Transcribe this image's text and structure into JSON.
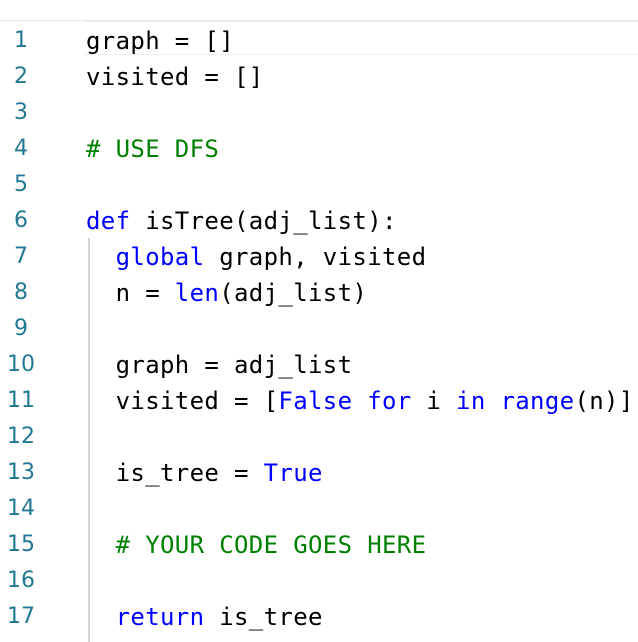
{
  "editor": {
    "lines": [
      {
        "number": "1",
        "tokens": [
          {
            "t": "graph = []",
            "k": "tx"
          }
        ]
      },
      {
        "number": "2",
        "tokens": [
          {
            "t": "visited = []",
            "k": "tx"
          }
        ]
      },
      {
        "number": "3",
        "tokens": []
      },
      {
        "number": "4",
        "tokens": [
          {
            "t": "# USE DFS",
            "k": "cm"
          }
        ]
      },
      {
        "number": "5",
        "tokens": []
      },
      {
        "number": "6",
        "tokens": [
          {
            "t": "def",
            "k": "kw"
          },
          {
            "t": " isTree(adj_list):",
            "k": "tx"
          }
        ]
      },
      {
        "number": "7",
        "tokens": [
          {
            "t": "  ",
            "k": "tx"
          },
          {
            "t": "global",
            "k": "kw"
          },
          {
            "t": " graph, visited",
            "k": "tx"
          }
        ]
      },
      {
        "number": "8",
        "tokens": [
          {
            "t": "  n = ",
            "k": "tx"
          },
          {
            "t": "len",
            "k": "kw"
          },
          {
            "t": "(adj_list)",
            "k": "tx"
          }
        ]
      },
      {
        "number": "9",
        "tokens": []
      },
      {
        "number": "10",
        "tokens": [
          {
            "t": "  graph = adj_list",
            "k": "tx"
          }
        ]
      },
      {
        "number": "11",
        "tokens": [
          {
            "t": "  visited = [",
            "k": "tx"
          },
          {
            "t": "False",
            "k": "kw"
          },
          {
            "t": " ",
            "k": "tx"
          },
          {
            "t": "for",
            "k": "kw"
          },
          {
            "t": " i ",
            "k": "tx"
          },
          {
            "t": "in",
            "k": "kw"
          },
          {
            "t": " ",
            "k": "tx"
          },
          {
            "t": "range",
            "k": "kw"
          },
          {
            "t": "(n)]",
            "k": "tx"
          }
        ]
      },
      {
        "number": "12",
        "tokens": []
      },
      {
        "number": "13",
        "tokens": [
          {
            "t": "  is_tree = ",
            "k": "tx"
          },
          {
            "t": "True",
            "k": "kw"
          }
        ]
      },
      {
        "number": "14",
        "tokens": []
      },
      {
        "number": "15",
        "tokens": [
          {
            "t": "  ",
            "k": "tx"
          },
          {
            "t": "# YOUR CODE GOES HERE",
            "k": "cm"
          }
        ]
      },
      {
        "number": "16",
        "tokens": []
      },
      {
        "number": "17",
        "tokens": [
          {
            "t": "  ",
            "k": "tx"
          },
          {
            "t": "return",
            "k": "kw"
          },
          {
            "t": " is_tree",
            "k": "tx"
          }
        ]
      }
    ]
  },
  "colors": {
    "line_number": "#237893",
    "keyword": "#0000ff",
    "comment": "#008000",
    "text": "#000000",
    "background": "#ffffff"
  }
}
